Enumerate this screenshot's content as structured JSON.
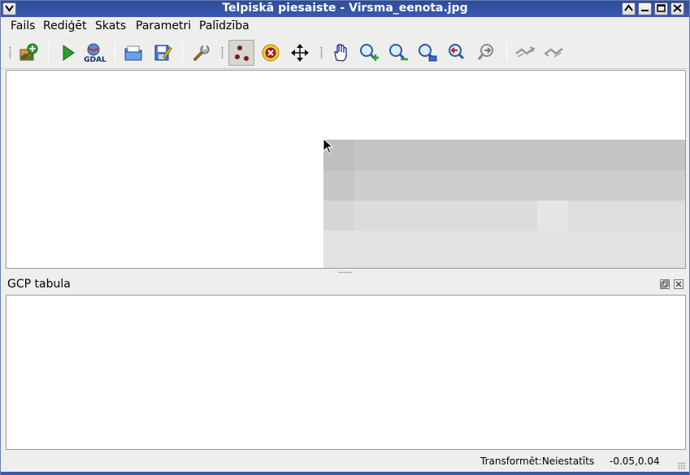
{
  "window": {
    "title": "Telpiskā piesaiste - Virsma_eenota.jpg",
    "menu_icon": "chevron-down-icon",
    "controls": [
      "scroll-up-icon",
      "minimize-icon",
      "maximize-icon",
      "close-icon"
    ]
  },
  "menu": {
    "items": [
      "Fails",
      "Rediģēt",
      "Skats",
      "Parametri",
      "Palīdzība"
    ]
  },
  "toolbar": {
    "tools": [
      "open-raster-icon",
      "start-georeferencing-icon",
      "generate-gdal-script-icon",
      "load-gcp-points-icon",
      "save-gcp-points-icon",
      "transformation-settings-icon",
      "add-point-icon",
      "delete-point-icon",
      "move-point-icon",
      "pan-icon",
      "zoom-in-icon",
      "zoom-out-icon",
      "zoom-to-layer-icon",
      "zoom-last-icon",
      "zoom-next-icon",
      "link-georef-to-qgis-icon",
      "link-qgis-to-georef-icon"
    ],
    "active_tool": "add-point-icon"
  },
  "dock": {
    "title": "GCP tabula"
  },
  "status": {
    "transform": "Transformēt:Neiestatīts",
    "coordinates": "-0.05,0.04"
  },
  "colors": {
    "titlebar": "#3a5ab3",
    "accent_green": "#2aa02a",
    "point_red": "#7a1a1a"
  }
}
